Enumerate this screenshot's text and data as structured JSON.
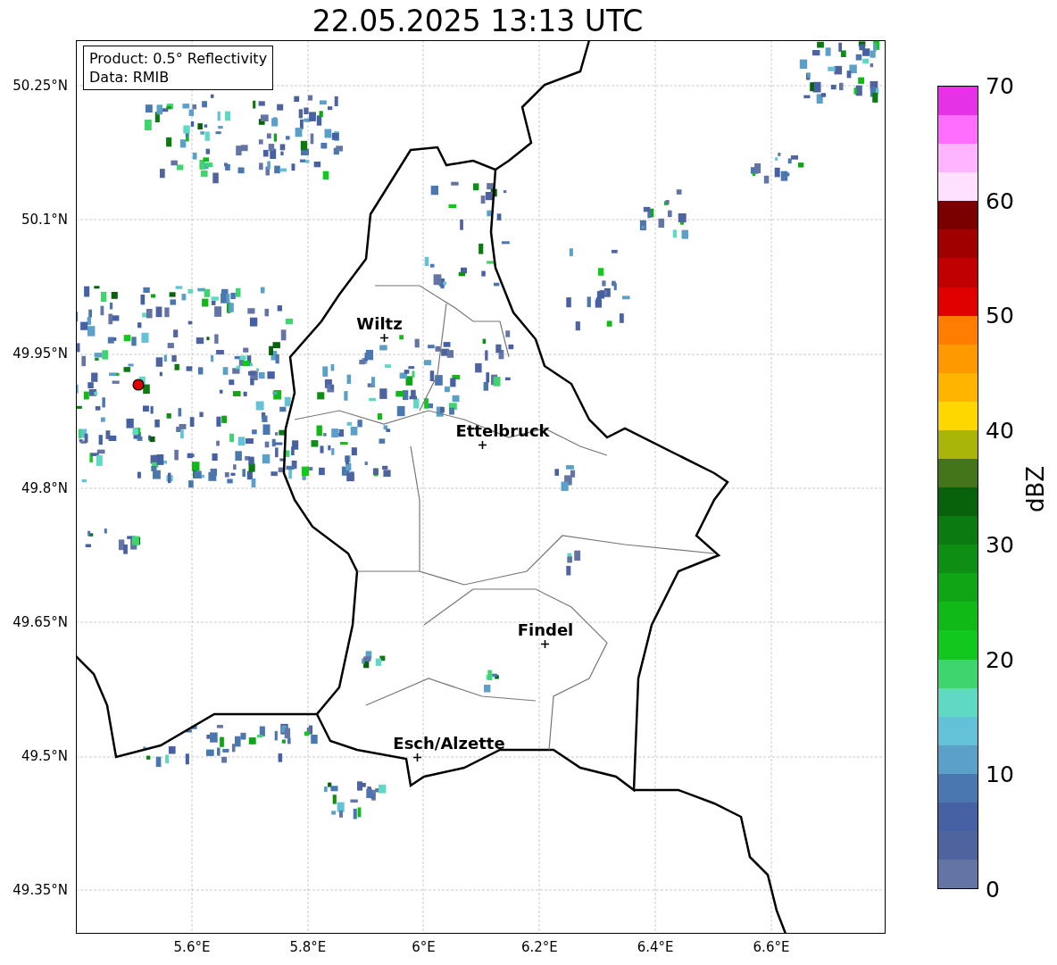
{
  "title": "22.05.2025 13:13 UTC",
  "info_box": [
    "Product: 0.5° Reflectivity",
    "Data: RMIB"
  ],
  "cities": [
    "Wiltz",
    "Ettelbruck",
    "Findel",
    "Esch/Alzette"
  ],
  "y_ticks": [
    "50.25°N",
    "50.1°N",
    "49.95°N",
    "49.8°N",
    "49.65°N",
    "49.5°N",
    "49.35°N"
  ],
  "x_ticks": [
    "5.6°E",
    "5.8°E",
    "6°E",
    "6.2°E",
    "6.4°E",
    "6.6°E"
  ],
  "colorbar": {
    "label": "dBZ",
    "ticks": [
      "70",
      "60",
      "50",
      "40",
      "30",
      "20",
      "10",
      "0"
    ],
    "bands": [
      {
        "color": "#e632e6"
      },
      {
        "color": "#ff6eff"
      },
      {
        "color": "#ffb4ff"
      },
      {
        "color": "#ffe0ff"
      },
      {
        "color": "#7a0000"
      },
      {
        "color": "#a00000"
      },
      {
        "color": "#c00000"
      },
      {
        "color": "#e00000"
      },
      {
        "color": "#ff7d00"
      },
      {
        "color": "#ff9900"
      },
      {
        "color": "#ffb400"
      },
      {
        "color": "#ffd700"
      },
      {
        "color": "#aab50a"
      },
      {
        "color": "#44751a"
      },
      {
        "color": "#07620b"
      },
      {
        "color": "#0b7a10"
      },
      {
        "color": "#0e8e12"
      },
      {
        "color": "#0fa514"
      },
      {
        "color": "#10b818"
      },
      {
        "color": "#12c81e"
      },
      {
        "color": "#3ed46e"
      },
      {
        "color": "#5fd8c4"
      },
      {
        "color": "#64c2d8"
      },
      {
        "color": "#5aa0c8"
      },
      {
        "color": "#4a77b0"
      },
      {
        "color": "#4560a3"
      },
      {
        "color": "#4f639f"
      },
      {
        "color": "#6475a5"
      }
    ]
  }
}
